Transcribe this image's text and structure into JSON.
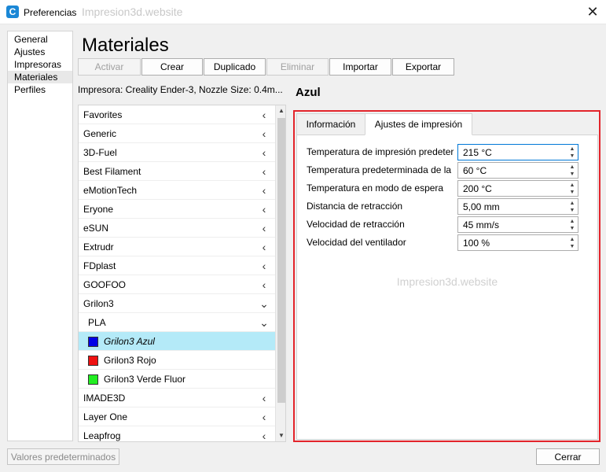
{
  "window": {
    "title": "Preferencias",
    "watermark": "Impresion3d.website",
    "app_icon": "cura-logo-icon",
    "close_glyph": "✕"
  },
  "sidebar": {
    "items": [
      {
        "label": "General"
      },
      {
        "label": "Ajustes"
      },
      {
        "label": "Impresoras"
      },
      {
        "label": "Materiales",
        "active": true
      },
      {
        "label": "Perfiles"
      }
    ]
  },
  "page": {
    "title": "Materiales"
  },
  "toolbar": {
    "activate": "Activar",
    "create": "Crear",
    "duplicate": "Duplicado",
    "remove": "Eliminar",
    "import": "Importar",
    "export": "Exportar"
  },
  "printer_info": "Impresora: Creality Ender-3, Nozzle Size: 0.4m...",
  "materials": {
    "brands": [
      {
        "label": "Favorites",
        "chevron": "‹"
      },
      {
        "label": "Generic",
        "chevron": "‹"
      },
      {
        "label": "3D-Fuel",
        "chevron": "‹"
      },
      {
        "label": "Best Filament",
        "chevron": "‹"
      },
      {
        "label": "eMotionTech",
        "chevron": "‹"
      },
      {
        "label": "Eryone",
        "chevron": "‹"
      },
      {
        "label": "eSUN",
        "chevron": "‹"
      },
      {
        "label": "Extrudr",
        "chevron": "‹"
      },
      {
        "label": "FDplast",
        "chevron": "‹"
      },
      {
        "label": "GOOFOO",
        "chevron": "‹"
      },
      {
        "label": "Grilon3",
        "chevron": "⌄"
      }
    ],
    "subgroup": {
      "label": "PLA",
      "chevron": "⌄"
    },
    "leaves": [
      {
        "label": "Grilon3 Azul",
        "color": "#0000e6",
        "selected": true
      },
      {
        "label": "Grilon3 Rojo",
        "color": "#ee1111"
      },
      {
        "label": "Grilon3 Verde Fluor",
        "color": "#22ee22"
      }
    ],
    "more_brands": [
      {
        "label": "IMADE3D",
        "chevron": "‹"
      },
      {
        "label": "Layer One",
        "chevron": "‹"
      },
      {
        "label": "Leapfrog",
        "chevron": "‹"
      }
    ],
    "scroll_up": "▲",
    "scroll_down": "▼"
  },
  "material_detail": {
    "name": "Azul",
    "tabs": [
      {
        "label": "Información"
      },
      {
        "label": "Ajustes de impresión",
        "active": true
      }
    ],
    "settings": [
      {
        "label": "Temperatura de impresión predeterminada",
        "value": "215 °C"
      },
      {
        "label": "Temperatura predeterminada de la placa de impresión",
        "value": "60 °C"
      },
      {
        "label": "Temperatura en modo de espera",
        "value": "200 °C"
      },
      {
        "label": "Distancia de retracción",
        "value": "5,00 mm"
      },
      {
        "label": "Velocidad de retracción",
        "value": "45 mm/s"
      },
      {
        "label": "Velocidad del ventilador",
        "value": "100 %"
      }
    ],
    "watermark": "Impresion3d.website",
    "spin_up": "▲",
    "spin_down": "▼"
  },
  "footer": {
    "defaults": "Valores predeterminados",
    "close": "Cerrar"
  },
  "colors": {
    "highlight": "#e3242b",
    "selection": "#b4eaf8",
    "accent": "#1a87d6"
  }
}
